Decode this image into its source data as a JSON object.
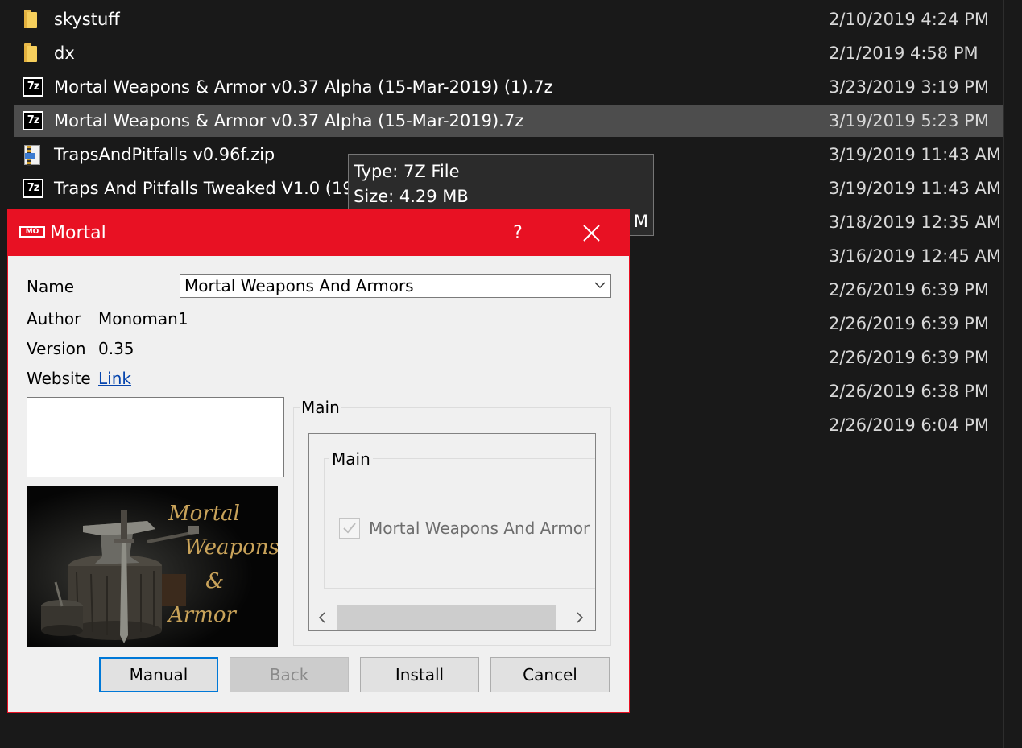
{
  "explorer": {
    "files": [
      {
        "name": "skystuff",
        "date": "2/10/2019 4:24 PM",
        "icon": "folder-icon"
      },
      {
        "name": "dx",
        "date": "2/1/2019 4:58 PM",
        "icon": "folder-icon"
      },
      {
        "name": "Mortal Weapons & Armor v0.37 Alpha (15-Mar-2019) (1).7z",
        "date": "3/23/2019 3:19 PM",
        "icon": "7z-archive-icon"
      },
      {
        "name": "Mortal Weapons & Armor v0.37 Alpha (15-Mar-2019).7z",
        "date": "3/19/2019 5:23 PM",
        "icon": "7z-archive-icon",
        "selected": true
      },
      {
        "name": "TrapsAndPitfalls v0.96f.zip",
        "date": "3/19/2019 11:43 AM",
        "icon": "zip-archive-icon"
      },
      {
        "name": "Traps And Pitfalls Tweaked V1.0 (19",
        "date": "3/19/2019 11:43 AM",
        "icon": "7z-archive-icon"
      },
      {
        "name": "",
        "date": "3/18/2019 12:35 AM",
        "icon": ""
      },
      {
        "name": "",
        "date": "3/16/2019 12:45 AM",
        "icon": ""
      },
      {
        "name": "",
        "date": "2/26/2019 6:39 PM",
        "icon": ""
      },
      {
        "name": "",
        "date": "2/26/2019 6:39 PM",
        "icon": ""
      },
      {
        "name": "",
        "date": "2/26/2019 6:39 PM",
        "icon": ""
      },
      {
        "name": "",
        "date": "2/26/2019 6:38 PM",
        "icon": ""
      },
      {
        "name": "",
        "date": "2/26/2019 6:04 PM",
        "icon": ""
      }
    ],
    "tooltip": {
      "type_line": "Type: 7Z File",
      "size_line": "Size: 4.29 MB",
      "partial_line": "M"
    }
  },
  "dialog": {
    "title": "Mortal",
    "app_icon_text": "MO",
    "help_label": "?",
    "name_label": "Name",
    "name_value": "Mortal Weapons And Armors",
    "author_label": "Author",
    "author_value": "Monoman1",
    "version_label": "Version",
    "version_value": "0.35",
    "website_label": "Website",
    "website_link": "Link",
    "preview_caption": [
      "Mortal",
      "Weapons",
      "&",
      "Armor"
    ],
    "outer_group_label": "Main",
    "inner_group_label": "Main",
    "option_label": "Mortal Weapons And Armor",
    "option_checked": true,
    "buttons": {
      "manual": "Manual",
      "back": "Back",
      "install": "Install",
      "cancel": "Cancel"
    },
    "accent_color": "#e81123"
  }
}
